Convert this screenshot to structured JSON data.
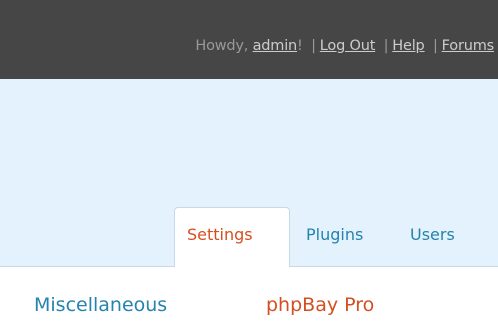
{
  "user_bar": {
    "greeting_prefix": "Howdy, ",
    "username": "admin",
    "greeting_suffix": "!",
    "separator": "|",
    "logout": "Log Out",
    "help": "Help",
    "forums": "Forums"
  },
  "tabs": [
    {
      "label": "Settings",
      "active": true
    },
    {
      "label": "Plugins",
      "active": false
    },
    {
      "label": "Users",
      "active": false
    }
  ],
  "submenu": [
    {
      "label": "Miscellaneous",
      "color": "#2583ad",
      "current": false
    },
    {
      "label": "phpBay Pro",
      "color": "#d54e21",
      "current": true
    }
  ],
  "colors": {
    "top_bar": "#464646",
    "header_background": "#e4f2fd",
    "link": "#2583ad",
    "active": "#d54e21"
  }
}
